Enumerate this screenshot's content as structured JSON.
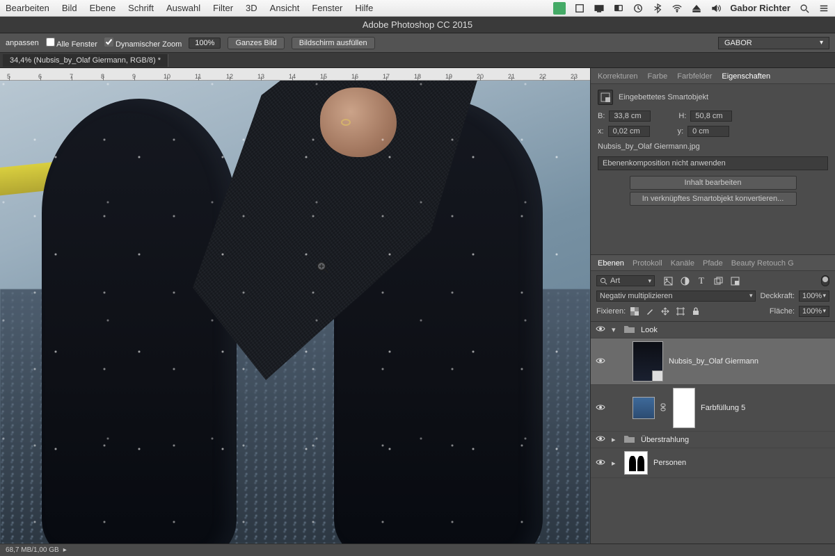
{
  "mac_menu": {
    "items": [
      "Bearbeiten",
      "Bild",
      "Ebene",
      "Schrift",
      "Auswahl",
      "Filter",
      "3D",
      "Ansicht",
      "Fenster",
      "Hilfe"
    ],
    "user": "Gabor Richter"
  },
  "app_title": "Adobe Photoshop CC 2015",
  "options_bar": {
    "fit_label": "anpassen",
    "all_windows": {
      "label": "Alle Fenster",
      "checked": false
    },
    "scrubby_zoom": {
      "label": "Dynamischer Zoom",
      "checked": true
    },
    "zoom_value": "100%",
    "fit_screen": "Ganzes Bild",
    "fill_screen": "Bildschirm ausfüllen",
    "workspace": "GABOR"
  },
  "doc_tab": "34,4% (Nubsis_by_Olaf Giermann, RGB/8) *",
  "ruler_marks": [
    "5",
    "6",
    "7",
    "8",
    "9",
    "10",
    "11",
    "12",
    "13",
    "14",
    "15",
    "16",
    "17",
    "18",
    "19",
    "20",
    "21",
    "22",
    "23"
  ],
  "properties_panel": {
    "tabs": [
      "Korrekturen",
      "Farbe",
      "Farbfelder",
      "Eigenschaften"
    ],
    "active_tab": 3,
    "title": "Eingebettetes Smartobjekt",
    "width_label": "B:",
    "width": "33,8 cm",
    "height_label": "H:",
    "height": "50,8 cm",
    "x_label": "x:",
    "x": "0,02 cm",
    "y_label": "y:",
    "y": "0 cm",
    "linked_file": "Nubsis_by_Olaf Giermann.jpg",
    "layer_comp_placeholder": "Ebenenkomposition nicht anwenden",
    "edit_contents": "Inhalt bearbeiten",
    "convert_linked": "In verknüpftes Smartobjekt konvertieren..."
  },
  "layers_panel": {
    "tabs": [
      "Ebenen",
      "Protokoll",
      "Kanäle",
      "Pfade",
      "Beauty Retouch G"
    ],
    "active_tab": 0,
    "kind_label": "Art",
    "blend_mode": "Negativ multiplizieren",
    "opacity_label": "Deckkraft:",
    "opacity": "100%",
    "lock_label": "Fixieren:",
    "fill_label": "Fläche:",
    "fill_opacity": "100%",
    "layers": [
      {
        "name": "Look",
        "type": "group"
      },
      {
        "name": "Nubsis_by_Olaf Giermann",
        "type": "smart",
        "selected": true
      },
      {
        "name": "Farbfüllung 5",
        "type": "fill"
      },
      {
        "name": "Überstrahlung",
        "type": "group_closed"
      },
      {
        "name": "Personen",
        "type": "mask"
      }
    ]
  },
  "status_bar": {
    "doc_size": "68,7 MB/1,00 GB"
  }
}
